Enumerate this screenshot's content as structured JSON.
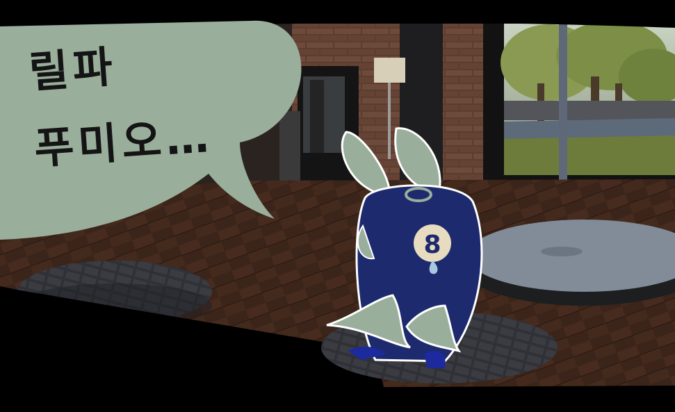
{
  "speech_bubble": {
    "lines": [
      "릴파",
      "푸미오…"
    ]
  },
  "colors": {
    "bubble": "#9aae9c",
    "character_body": "#1d2a6e",
    "character_skin": "#9aae9c",
    "floor": "#3a2418",
    "brick": "#5a3d30",
    "grass": "#6e7d3a",
    "border": "#000000"
  },
  "scene": {
    "characters": [
      "character"
    ],
    "badge_icon": "number-8-emblem"
  }
}
